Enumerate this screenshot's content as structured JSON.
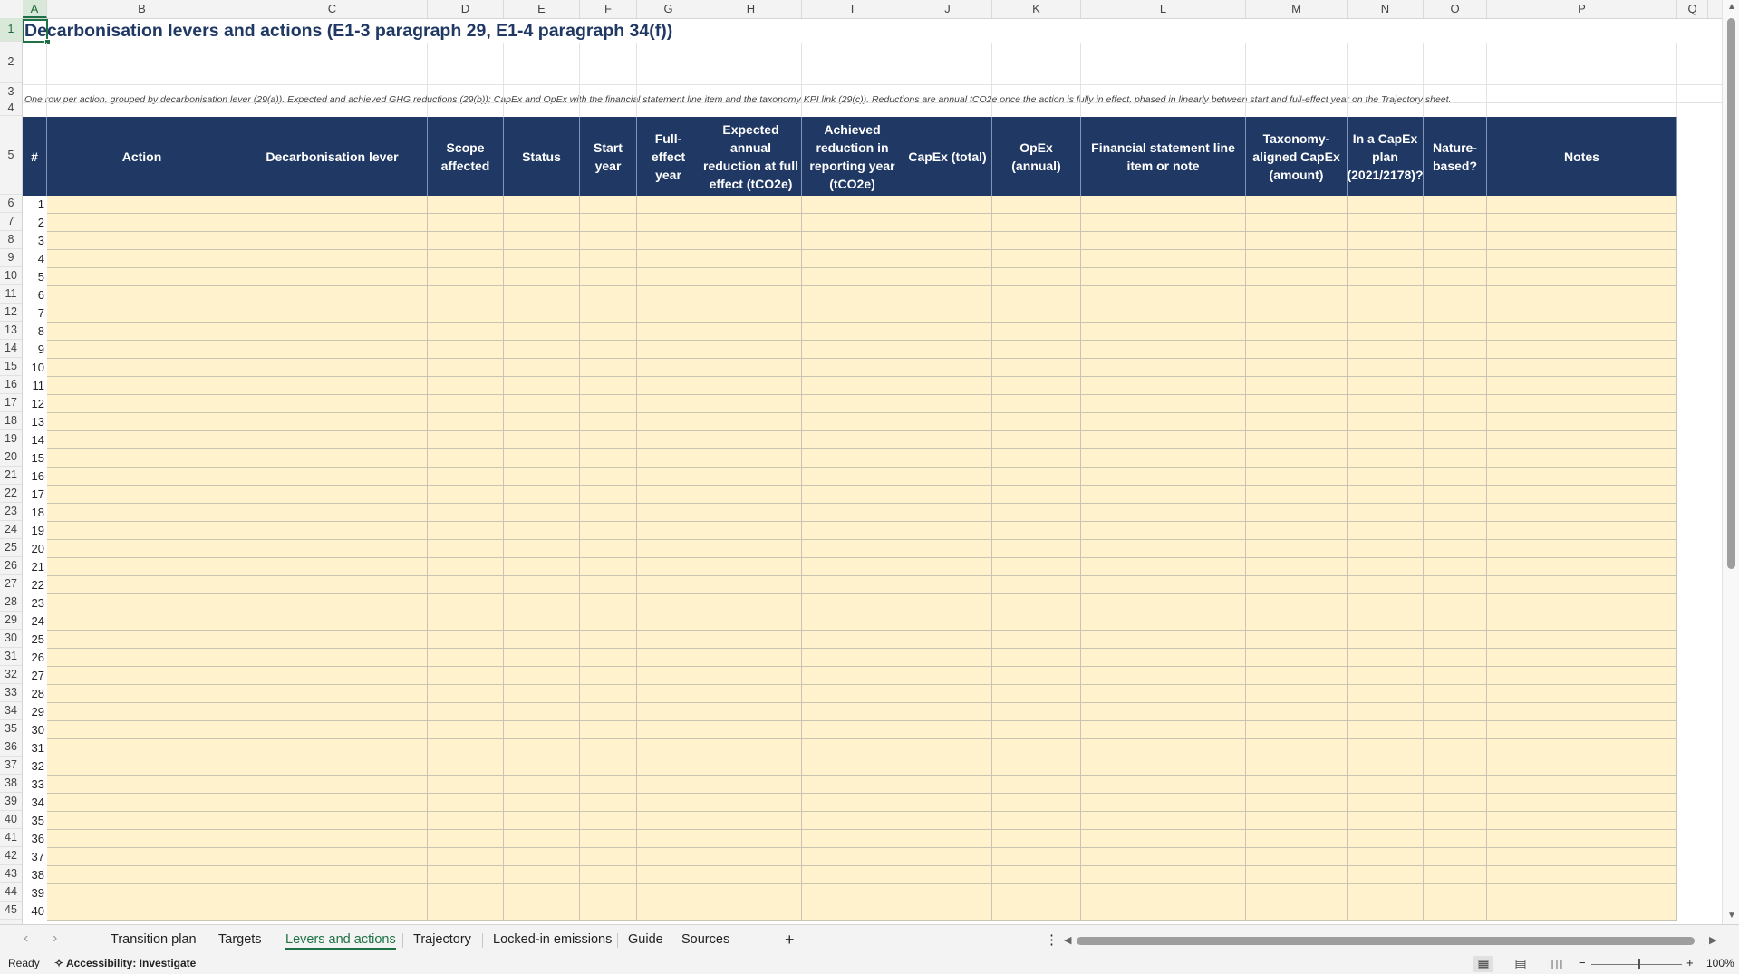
{
  "sheet": {
    "columns": [
      "A",
      "B",
      "C",
      "D",
      "E",
      "F",
      "G",
      "H",
      "I",
      "J",
      "K",
      "L",
      "M",
      "N",
      "O",
      "P",
      "Q"
    ],
    "selected_column": "A",
    "row_numbers": [
      "1",
      "2",
      "3",
      "4",
      "5",
      "6",
      "7",
      "8",
      "9",
      "10",
      "11",
      "12",
      "13",
      "14",
      "15",
      "16",
      "17",
      "18",
      "19",
      "20",
      "21",
      "22",
      "23",
      "24",
      "25",
      "26",
      "27",
      "28",
      "29",
      "30",
      "31",
      "32",
      "33",
      "34",
      "35",
      "36",
      "37",
      "38",
      "39",
      "40",
      "41",
      "42",
      "43",
      "44",
      "45"
    ],
    "selected_row": "1",
    "title": "Decarbonisation levers and actions (E1-3 paragraph 29, E1-4 paragraph 34(f))",
    "note": "One row per action, grouped by decarbonisation lever (29(a)). Expected and achieved GHG reductions (29(b)); CapEx and OpEx with the financial statement line item and the taxonomy KPI link (29(c)). Reductions are annual tCO2e once the action is fully in effect, phased in linearly between start and full-effect year on the Trajectory sheet.",
    "headers": [
      "#",
      "Action",
      "Decarbonisation lever",
      "Scope affected",
      "Status",
      "Start year",
      "Full-effect year",
      "Expected annual reduction at full effect (tCO2e)",
      "Achieved reduction in reporting year (tCO2e)",
      "CapEx (total)",
      "OpEx (annual)",
      "Financial statement line item or note",
      "Taxonomy-aligned CapEx (amount)",
      "In a CapEx plan (2021/2178)?",
      "Nature-based?",
      "Notes"
    ],
    "row_ids": [
      "1",
      "2",
      "3",
      "4",
      "5",
      "6",
      "7",
      "8",
      "9",
      "10",
      "11",
      "12",
      "13",
      "14",
      "15",
      "16",
      "17",
      "18",
      "19",
      "20",
      "21",
      "22",
      "23",
      "24",
      "25",
      "26",
      "27",
      "28",
      "29",
      "30",
      "31",
      "32",
      "33",
      "34",
      "35",
      "36",
      "37",
      "38",
      "39",
      "40"
    ],
    "colors": {
      "header_fill": "#1f3864",
      "input_fill": "#fff2cc",
      "accent": "#1e7145"
    }
  },
  "tabs": [
    "Transition plan",
    "Targets",
    "Levers and actions",
    "Trajectory",
    "Locked-in emissions",
    "Guide",
    "Sources"
  ],
  "active_tab": "Levers and actions",
  "tabbar": {
    "add_icon": "+",
    "more_icon": "⋮"
  },
  "status": {
    "ready": "Ready",
    "accessibility": "Accessibility: Investigate",
    "zoom": "100%",
    "zoom_minus": "−",
    "zoom_plus": "+"
  }
}
